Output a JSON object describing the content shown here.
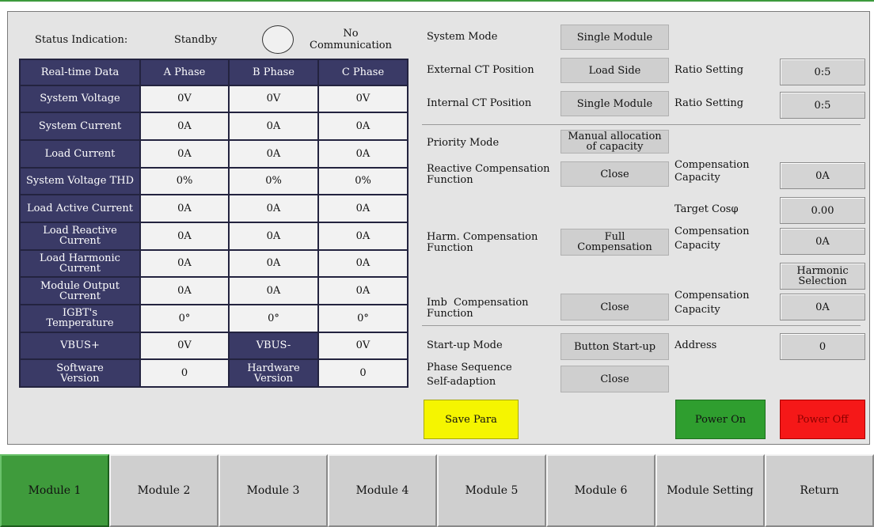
{
  "status": {
    "label": "Status Indication:",
    "state": "Standby",
    "communication_line1": "No",
    "communication_line2": "Communication"
  },
  "realtime_table": {
    "header": [
      "Real-time Data",
      "A Phase",
      "B Phase",
      "C Phase"
    ],
    "rows": [
      {
        "label": [
          "System Voltage"
        ],
        "a": "0V",
        "b": "0V",
        "c": "0V"
      },
      {
        "label": [
          "System Current"
        ],
        "a": "0A",
        "b": "0A",
        "c": "0A"
      },
      {
        "label": [
          "Load Current"
        ],
        "a": "0A",
        "b": "0A",
        "c": "0A"
      },
      {
        "label": [
          "System Voltage THD"
        ],
        "a": "0%",
        "b": "0%",
        "c": "0%"
      },
      {
        "label": [
          "Load Active Current"
        ],
        "a": "0A",
        "b": "0A",
        "c": "0A"
      },
      {
        "label": [
          "Load Reactive",
          "Current"
        ],
        "a": "0A",
        "b": "0A",
        "c": "0A"
      },
      {
        "label": [
          "Load Harmonic",
          "Current"
        ],
        "a": "0A",
        "b": "0A",
        "c": "0A"
      },
      {
        "label": [
          "Module Output",
          "Current"
        ],
        "a": "0A",
        "b": "0A",
        "c": "0A"
      },
      {
        "label": [
          "IGBT's",
          "Temperature"
        ],
        "a": "0°",
        "b": "0°",
        "c": "0°"
      }
    ],
    "vbus_plus_label": "VBUS+",
    "vbus_plus_value": "0V",
    "vbus_minus_label": "VBUS-",
    "vbus_minus_value": "0V",
    "software_label": [
      "Software",
      "Version"
    ],
    "software_value": "0",
    "hardware_label": [
      "Hardware",
      "Version"
    ],
    "hardware_value": "0"
  },
  "settings": {
    "system_mode": {
      "label": "System Mode",
      "value": "Single Module"
    },
    "external_ct": {
      "label": "External CT Position",
      "value": "Load Side",
      "ratio_label": "Ratio Setting",
      "ratio_value": "0:5"
    },
    "internal_ct": {
      "label": "Internal CT Position",
      "value": "Single Module",
      "ratio_label": "Ratio Setting",
      "ratio_value": "0:5"
    },
    "priority_mode": {
      "label": "Priority Mode",
      "value_line1": "Manual allocation",
      "value_line2": "of capacity"
    },
    "reactive_comp": {
      "label_line1": "Reactive Compensation",
      "label_line2": "Function",
      "value": "Close",
      "cap_label_line1": "Compensation",
      "cap_label_line2": "Capacity",
      "cap_value": "0A"
    },
    "target_cos": {
      "label": "Target Cosφ",
      "value": "0.00"
    },
    "harm_comp": {
      "label_line1": "Harm. Compensation",
      "label_line2": "Function",
      "value_line1": "Full",
      "value_line2": "Compensation",
      "cap_label_line1": "Compensation",
      "cap_label_line2": "Capacity",
      "cap_value": "0A"
    },
    "harmonic_selection": {
      "line1": "Harmonic",
      "line2": "Selection"
    },
    "imb_comp": {
      "label_line1": "Imb  Compensation",
      "label_line2": "Function",
      "value": "Close",
      "cap_label_line1": "Compensation",
      "cap_label_line2": "Capacity",
      "cap_value": "0A"
    },
    "startup_mode": {
      "label": "Start-up Mode",
      "value": "Button Start-up",
      "address_label": "Address",
      "address_value": "0"
    },
    "phase_seq": {
      "label_line1": "Phase Sequence",
      "label_line2": "Self-adaption",
      "value": "Close"
    }
  },
  "actions": {
    "save": "Save Para",
    "power_on": "Power On",
    "power_off": "Power Off"
  },
  "tabs": [
    "Module 1",
    "Module 2",
    "Module 3",
    "Module 4",
    "Module 5",
    "Module 6",
    "Module Setting",
    "Return"
  ],
  "active_tab_index": 0,
  "colors": {
    "header_cell": "#3a3a66",
    "save_button": "#f5f500",
    "power_on": "#2f9e2f",
    "power_off": "#f51818",
    "active_tab": "#3f9b3c"
  }
}
